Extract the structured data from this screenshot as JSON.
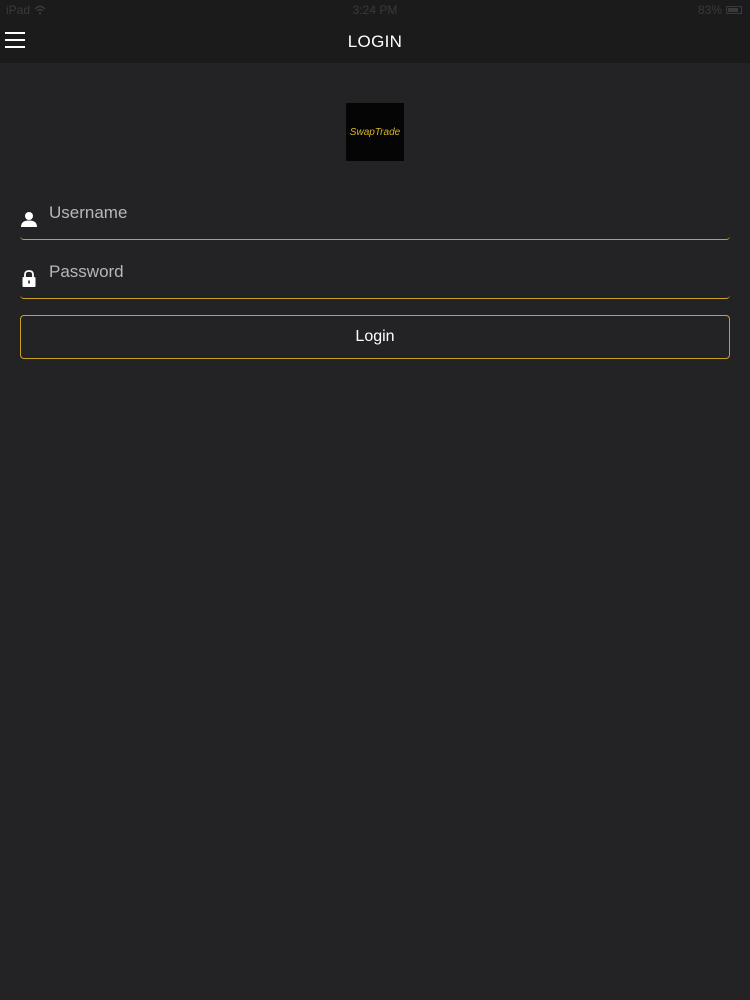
{
  "status_bar": {
    "device": "iPad",
    "time": "3:24 PM",
    "battery": "83%"
  },
  "nav": {
    "title": "LOGIN",
    "menu_icon": "hamburger-menu-icon"
  },
  "logo": {
    "text": "SwapTrade"
  },
  "form": {
    "username_placeholder": "Username",
    "username_value": "",
    "username_icon": "user-icon",
    "password_placeholder": "Password",
    "password_value": "",
    "password_icon": "lock-icon",
    "login_label": "Login"
  },
  "colors": {
    "background": "#232325",
    "bar": "#1b1b1c",
    "accent": "#c9a127",
    "logo_text": "#d7b52b"
  }
}
